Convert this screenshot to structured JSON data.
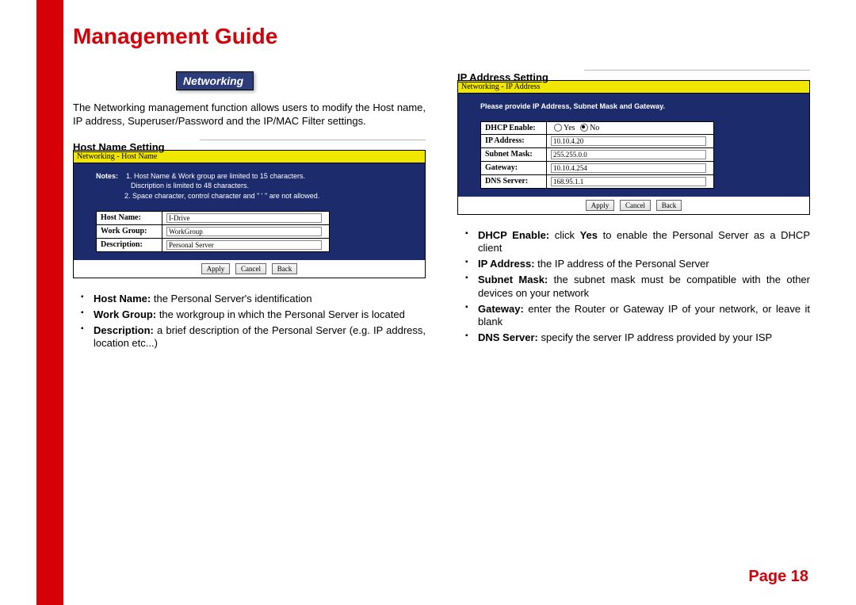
{
  "title": "Management Guide",
  "networking_label": "Networking",
  "intro": "The Networking management function allows users to modify the Host name, IP address, Superuser/Password and the IP/MAC Filter settings.",
  "left": {
    "heading": "Host Name Setting",
    "sb_title": "Networking - Host Name",
    "notes_label": "Notes:",
    "note1a": "1. Host Name & Work group are limited to 15 characters.",
    "note1b": "Discription is limited to 48 characters.",
    "note2": "2. Space character, control character and \" ' \" are not allowed.",
    "row1_label": "Host Name:",
    "row1_value": "I-Drive",
    "row2_label": "Work Group:",
    "row2_value": "WorkGroup",
    "row3_label": "Description:",
    "row3_value": "Personal Server",
    "btn_apply": "Apply",
    "btn_cancel": "Cancel",
    "btn_back": "Back",
    "b1_bold": "Host Name:",
    "b1_text": " the Personal Server's identification",
    "b2_bold": "Work Group:",
    "b2_text": " the workgroup in which the Personal Server is located",
    "b3_bold": "Description:",
    "b3_text": " a brief description of the Personal Server (e.g. IP address, location etc...)"
  },
  "right": {
    "heading": "IP Address Setting",
    "sb_title": "Networking - IP Address",
    "instruct": "Please provide IP Address, Subnet Mask and Gateway.",
    "row1_label": "DHCP Enable:",
    "row1_yes": "Yes",
    "row1_no": "No",
    "row2_label": "IP Address:",
    "row2_value": "10.10.4.20",
    "row3_label": "Subnet Mask:",
    "row3_value": "255.255.0.0",
    "row4_label": "Gateway:",
    "row4_value": "10.10.4.254",
    "row5_label": "DNS Server:",
    "row5_value": "168.95.1.1",
    "btn_apply": "Apply",
    "btn_cancel": "Cancel",
    "btn_back": "Back",
    "b1_bold": "DHCP Enable:",
    "b1_mid": " click ",
    "b1_yes": "Yes",
    "b1_text": " to enable the Personal Server as a DHCP client",
    "b2_bold": "IP Address:",
    "b2_text": " the IP address of the Personal Server",
    "b3_bold": "Subnet Mask:",
    "b3_text": " the subnet mask must be compatible with the other devices on your network",
    "b4_bold": "Gateway:",
    "b4_text": " enter the Router or Gateway IP of your network, or leave it blank",
    "b5_bold": "DNS Server:",
    "b5_text": " specify the server IP address provided by your ISP"
  },
  "page_number": "Page 18",
  "chart_data": {
    "type": "table",
    "title": "Networking - IP Address",
    "rows": [
      {
        "label": "DHCP Enable",
        "value": "No"
      },
      {
        "label": "IP Address",
        "value": "10.10.4.20"
      },
      {
        "label": "Subnet Mask",
        "value": "255.255.0.0"
      },
      {
        "label": "Gateway",
        "value": "10.10.4.254"
      },
      {
        "label": "DNS Server",
        "value": "168.95.1.1"
      }
    ]
  }
}
